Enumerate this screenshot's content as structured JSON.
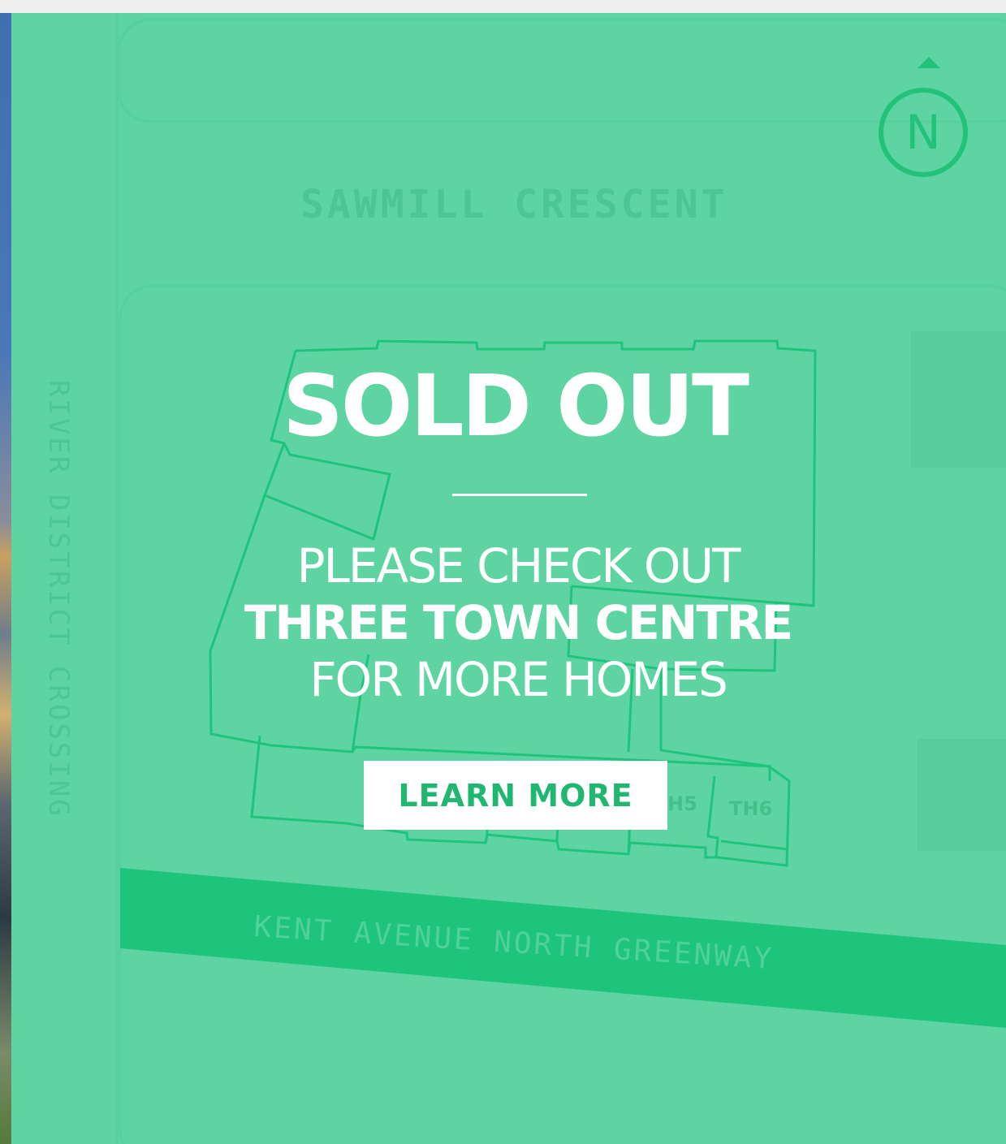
{
  "map": {
    "streets": {
      "top": "SAWMILL CRESCENT",
      "left": "RIVER DISTRICT CROSSING",
      "bottom": "KENT AVENUE NORTH GREENWAY"
    },
    "units": [
      "H5",
      "TH6"
    ],
    "compass": {
      "label": "N",
      "icon": "north-compass-icon"
    }
  },
  "overlay": {
    "title": "SOLD OUT",
    "message_line1": "PLEASE CHECK OUT",
    "message_line2": "THREE TOWN CENTRE",
    "message_line3": "FOR MORE HOMES",
    "button_label": "LEARN MORE"
  },
  "colors": {
    "map_background": "#5dd4a2",
    "accent_green": "#22c27a",
    "text_white": "#ffffff"
  }
}
